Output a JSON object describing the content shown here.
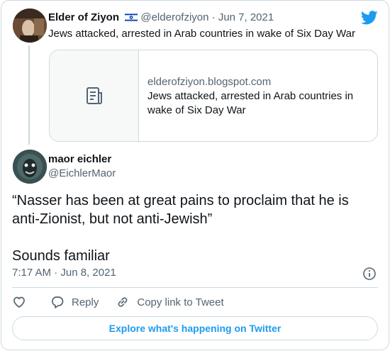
{
  "parent_tweet": {
    "author_name": "Elder of Ziyon",
    "flag_icon": "israel-flag-icon",
    "handle": "@elderofziyon",
    "separator": "·",
    "date": "Jun 7, 2021",
    "text": "Jews attacked, arrested in Arab countries in wake of Six Day War",
    "link_card": {
      "icon": "document-icon",
      "domain": "elderofziyon.blogspot.com",
      "title": "Jews attacked, arrested in Arab countries in wake of Six Day War"
    }
  },
  "main_tweet": {
    "author_name": "maor eichler",
    "handle": "@EichlerMaor",
    "text_lines": [
      "“Nasser has been at great pains to proclaim that he is anti-Zionist, but not anti-Jewish”",
      "Sounds familiar"
    ],
    "timestamp": "7:17 AM · Jun 8, 2021"
  },
  "actions": {
    "like_icon": "heart-icon",
    "reply_label": "Reply",
    "copy_label": "Copy link to Tweet"
  },
  "explore_label": "Explore what's happening on Twitter",
  "colors": {
    "accent": "#1d9bf0",
    "secondary_text": "#536471",
    "border": "#cfd9de"
  }
}
